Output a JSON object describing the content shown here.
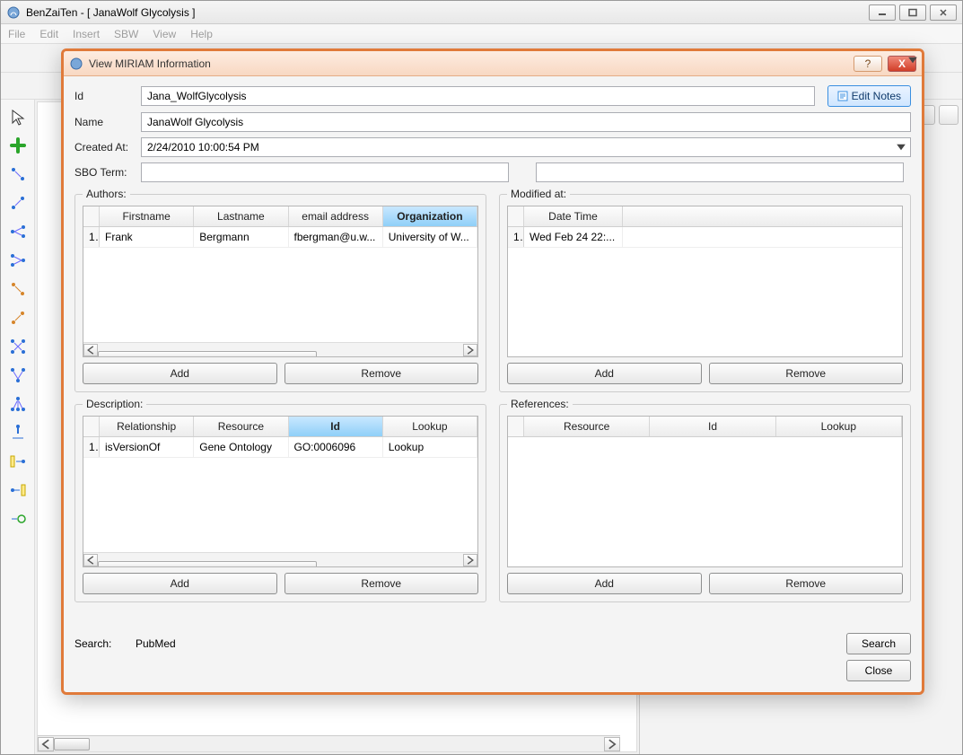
{
  "main_window": {
    "title": "BenZaiTen - [ JanaWolf Glycolysis ]",
    "menus": {
      "file": "File",
      "edit": "Edit",
      "insert": "Insert",
      "sbw": "SBW",
      "view": "View",
      "help": "Help"
    }
  },
  "dialog": {
    "title": "View MIRIAM Information",
    "help": "?",
    "close_glyph": "X",
    "edit_notes": "Edit Notes",
    "labels": {
      "id": "Id",
      "name": "Name",
      "created": "Created At:",
      "sbo": "SBO Term:",
      "search": "Search:"
    },
    "id_value": "Jana_WolfGlycolysis",
    "name_value": "JanaWolf Glycolysis",
    "created_value": "2/24/2010 10:00:54 PM",
    "sbo_left": "",
    "sbo_right": "",
    "authors": {
      "legend": "Authors:",
      "headers": {
        "first": "Firstname",
        "last": "Lastname",
        "email": "email address",
        "org": "Organization"
      },
      "rows": [
        {
          "n": "1",
          "first": "Frank",
          "last": "Bergmann",
          "email": "fbergman@u.w...",
          "org": "University of W..."
        }
      ],
      "add": "Add",
      "remove": "Remove"
    },
    "modified": {
      "legend": "Modified at:",
      "headers": {
        "dt": "Date Time"
      },
      "rows": [
        {
          "n": "1",
          "dt": "Wed Feb 24 22:..."
        }
      ],
      "add": "Add",
      "remove": "Remove"
    },
    "description": {
      "legend": "Description:",
      "headers": {
        "rel": "Relationship",
        "res": "Resource",
        "id": "Id",
        "look": "Lookup"
      },
      "rows": [
        {
          "n": "1",
          "rel": "isVersionOf",
          "res": "Gene Ontology",
          "id": "GO:0006096",
          "look": "Lookup"
        }
      ],
      "add": "Add",
      "remove": "Remove"
    },
    "references": {
      "legend": "References:",
      "headers": {
        "res": "Resource",
        "id": "Id",
        "look": "Lookup"
      },
      "add": "Add",
      "remove": "Remove"
    },
    "search_source": "PubMed",
    "search_text": "",
    "search_btn": "Search",
    "close_btn": "Close"
  }
}
